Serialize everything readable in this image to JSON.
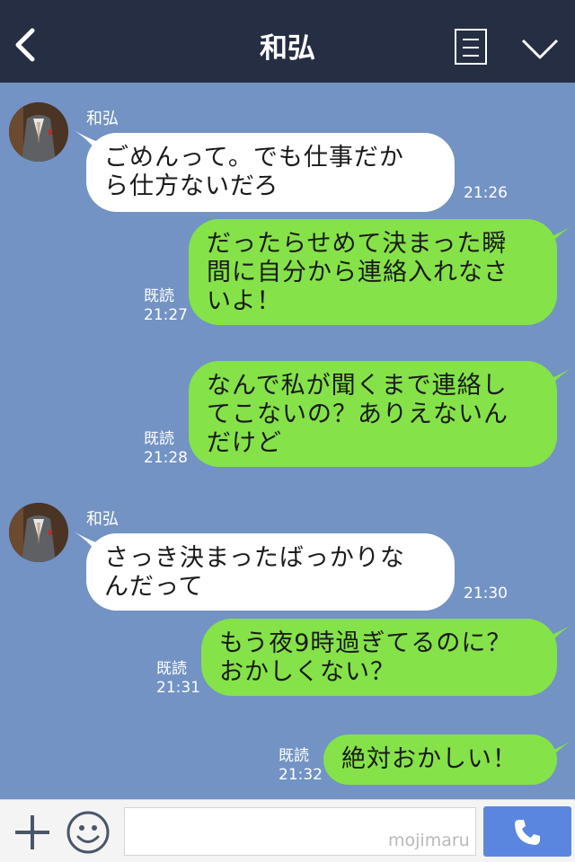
{
  "header": {
    "title": "和弘",
    "back_icon": "chevron-left-icon",
    "menu_icon": "list-icon",
    "more_icon": "chevron-down-icon"
  },
  "messages": [
    {
      "direction": "in",
      "sender": "和弘",
      "text": "ごめんって。でも仕事だか\nら仕方ないだろ",
      "time": "21:26"
    },
    {
      "direction": "out",
      "read_label": "既読",
      "time": "21:27",
      "text": "だったらせめて決まった瞬\n間に自分から連絡入れなさ\nいよ！"
    },
    {
      "direction": "out",
      "read_label": "既読",
      "time": "21:28",
      "text": "なんで私が聞くまで連絡し\nてこないの？ありえないん\nだけど"
    },
    {
      "direction": "in",
      "sender": "和弘",
      "text": "さっき決まったばっかりな\nんだって",
      "time": "21:30"
    },
    {
      "direction": "out",
      "read_label": "既読",
      "time": "21:31",
      "text": "もう夜9時過ぎてるのに？\nおかしくない？"
    },
    {
      "direction": "out",
      "read_label": "既読",
      "time": "21:32",
      "text": "絶対おかしい！"
    }
  ],
  "input": {
    "placeholder": "",
    "watermark": "mojimaru",
    "plus_icon": "plus-icon",
    "sticker_icon": "smiley-icon",
    "send_icon": "phone-icon"
  },
  "colors": {
    "header_bg": "#252e42",
    "chat_bg": "#7293c3",
    "incoming_bubble": "#ffffff",
    "outgoing_bubble": "#85e249",
    "send_button": "#5a86e0"
  }
}
